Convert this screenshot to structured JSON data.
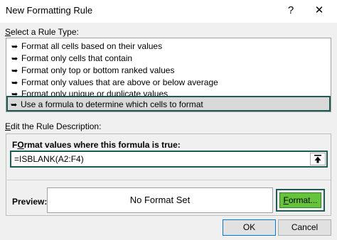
{
  "dialog": {
    "title": "New Formatting Rule",
    "help_glyph": "?",
    "close_glyph": "✕"
  },
  "rule_type": {
    "label_accel": "S",
    "label_rest": "elect a Rule Type:",
    "items": [
      {
        "label": "Format all cells based on their values"
      },
      {
        "label": "Format only cells that contain"
      },
      {
        "label": "Format only top or bottom ranked values"
      },
      {
        "label": "Format only values that are above or below average"
      },
      {
        "label": "Format only unique or duplicate values"
      },
      {
        "label": "Use a formula to determine which cells to format"
      }
    ],
    "selected_index": 5,
    "arrow_glyph": "➥"
  },
  "description": {
    "label_accel": "E",
    "label_rest": "dit the Rule Description:",
    "formula_label_accel": "O",
    "formula_label_pre": "F",
    "formula_label_rest": "rmat values where this formula is true:",
    "formula_value": "=ISBLANK(A2:F4)",
    "preview_label": "Preview:",
    "preview_text": "No Format Set",
    "format_button_accel": "F",
    "format_button_rest": "ormat..."
  },
  "buttons": {
    "ok": "OK",
    "cancel": "Cancel"
  },
  "colors": {
    "highlight_border": "#1e5b55",
    "format_button": "#66c43c"
  }
}
